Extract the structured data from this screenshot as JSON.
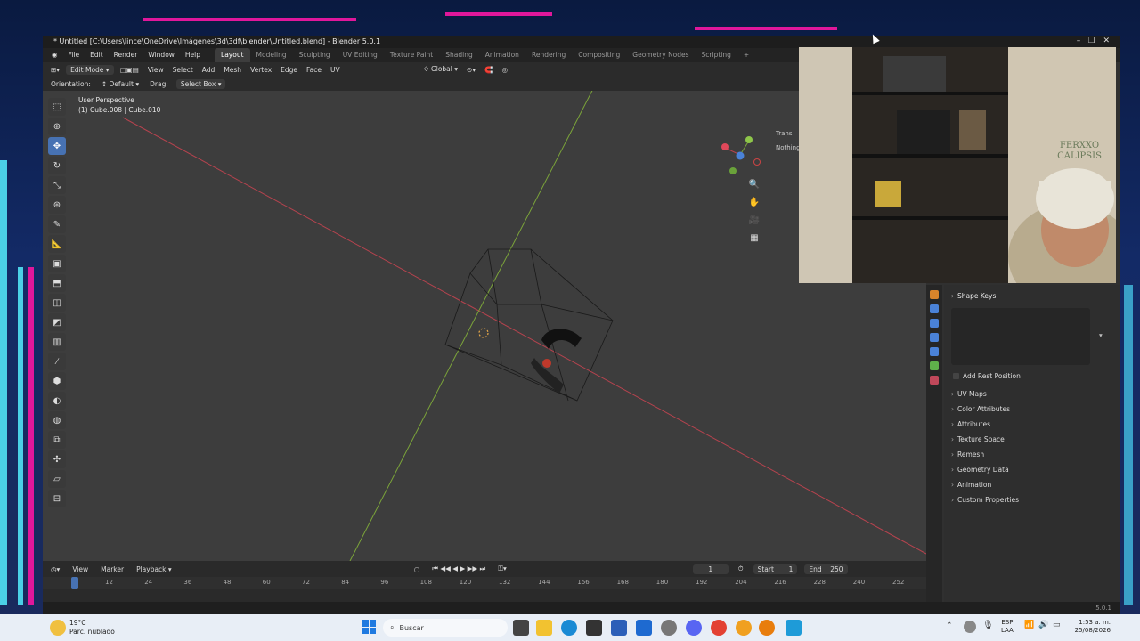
{
  "window": {
    "title": "* Untitled [C:\\Users\\lince\\OneDrive\\Imágenes\\3d\\3df\\blender\\Untitled.blend] - Blender 5.0.1"
  },
  "menu": {
    "items": [
      "File",
      "Edit",
      "Render",
      "Window",
      "Help"
    ],
    "workspaces": [
      "Layout",
      "Modeling",
      "Sculpting",
      "UV Editing",
      "Texture Paint",
      "Shading",
      "Animation",
      "Rendering",
      "Compositing",
      "Geometry Nodes",
      "Scripting"
    ],
    "active_workspace": "Layout",
    "add_tab": "+"
  },
  "header": {
    "mode": "Edit Mode",
    "menus": [
      "View",
      "Select",
      "Add",
      "Mesh",
      "Vertex",
      "Edge",
      "Face",
      "UV"
    ],
    "transform_orientation": "Global"
  },
  "tool_settings": {
    "orientation_label": "Orientation:",
    "orientation_value": "Default",
    "drag_label": "Drag:",
    "drag_value": "Select Box"
  },
  "viewport": {
    "view_name": "User Perspective",
    "object_info": "(1) Cube.008 | Cube.010",
    "sidebar_tab": "Trans",
    "sidebar_text": "Nothing"
  },
  "properties": {
    "panels": [
      {
        "label": "UV Maps"
      },
      {
        "label": "Color Attributes"
      },
      {
        "label": "Attributes"
      },
      {
        "label": "Texture Space"
      },
      {
        "label": "Remesh"
      },
      {
        "label": "Geometry Data"
      },
      {
        "label": "Animation"
      },
      {
        "label": "Custom Properties"
      }
    ],
    "shape_keys_label": "Shape Keys",
    "add_rest_position": "Add Rest Position"
  },
  "timeline": {
    "menus": [
      "View",
      "Marker",
      "Playback"
    ],
    "current_frame": "1",
    "start_label": "Start",
    "start_value": "1",
    "end_label": "End",
    "end_value": "250",
    "ruler": [
      "12",
      "24",
      "36",
      "48",
      "60",
      "72",
      "84",
      "96",
      "108",
      "120",
      "132",
      "144",
      "156",
      "168",
      "180",
      "192",
      "204",
      "216",
      "228",
      "240",
      "252"
    ]
  },
  "status": {
    "version": "5.0.1"
  },
  "webcam": {
    "cap_text": "FERXXO CALIPSIS"
  },
  "taskbar": {
    "weather_temp": "19°C",
    "weather_desc": "Parc. nublado",
    "search_placeholder": "Buscar",
    "lang_line1": "ESP",
    "lang_line2": "LAA",
    "time": "1:53 a. m.",
    "date": "25/08/2026"
  }
}
